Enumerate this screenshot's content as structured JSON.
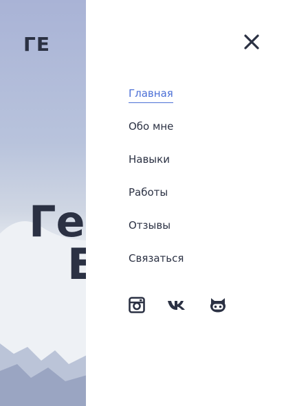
{
  "hero": {
    "logo": "ГЕ",
    "title_line1": "Гер",
    "title_line2": "Е"
  },
  "menu": {
    "close_icon": "close-icon",
    "items": [
      {
        "label": "Главная",
        "active": true
      },
      {
        "label": "Обо мне",
        "active": false
      },
      {
        "label": "Навыки",
        "active": false
      },
      {
        "label": "Работы",
        "active": false
      },
      {
        "label": "Отзывы",
        "active": false
      },
      {
        "label": "Связаться",
        "active": false
      }
    ],
    "socials": [
      {
        "icon": "instagram-icon"
      },
      {
        "icon": "vk-icon"
      },
      {
        "icon": "github-icon"
      }
    ]
  },
  "colors": {
    "accent": "#4b6fd6",
    "text": "#2b3143"
  }
}
